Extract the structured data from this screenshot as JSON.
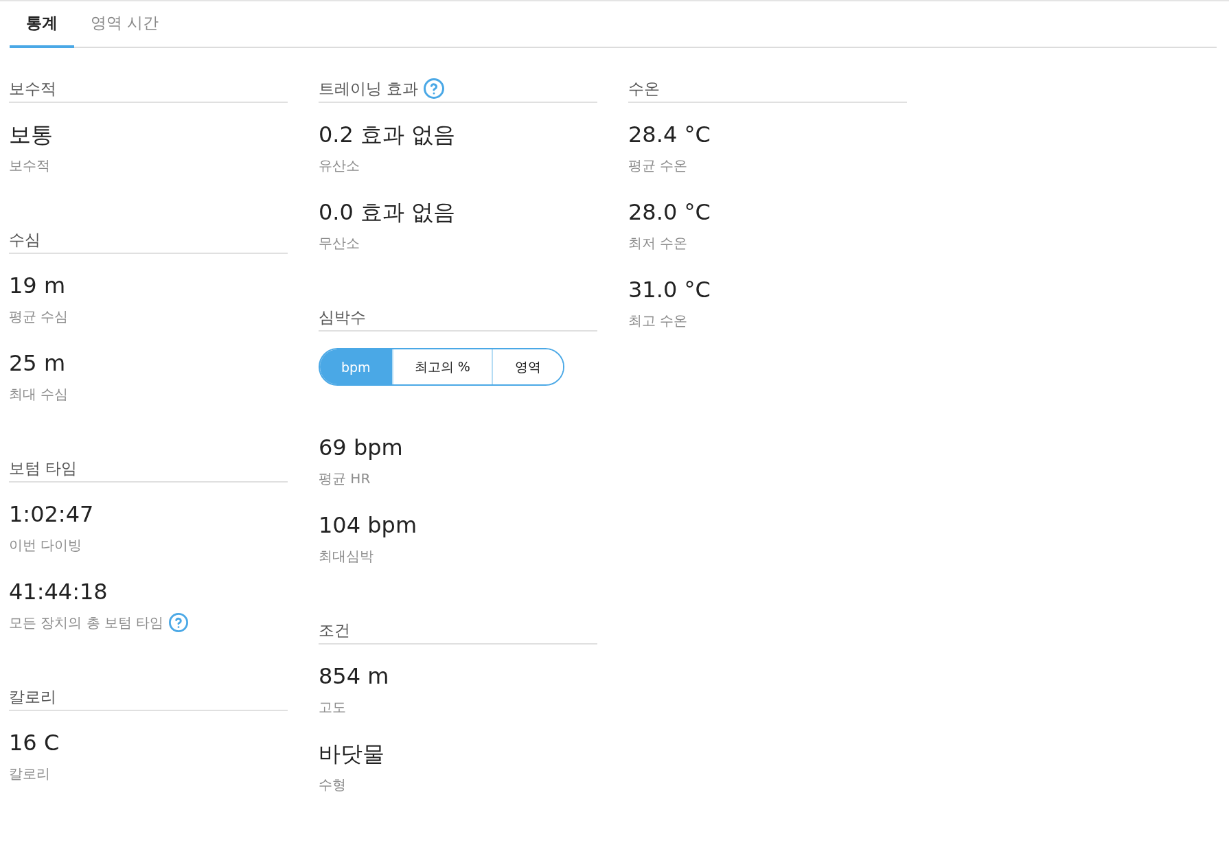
{
  "tabs": [
    {
      "label": "통계",
      "selected": true
    },
    {
      "label": "영역 시간",
      "selected": false
    }
  ],
  "columns": [
    {
      "sections": [
        {
          "title": "보수적",
          "help": false,
          "stats": [
            {
              "value": "보통",
              "label": "보수적",
              "help": false
            }
          ]
        },
        {
          "title": "수심",
          "help": false,
          "stats": [
            {
              "value": "19 m",
              "label": "평균 수심",
              "help": false
            },
            {
              "value": "25 m",
              "label": "최대 수심",
              "help": false
            }
          ]
        },
        {
          "title": "보텀 타임",
          "help": false,
          "stats": [
            {
              "value": "1:02:47",
              "label": "이번 다이빙",
              "help": false
            },
            {
              "value": "41:44:18",
              "label": "모든 장치의 총 보텀 타임",
              "help": true
            }
          ]
        },
        {
          "title": "칼로리",
          "help": false,
          "stats": [
            {
              "value": "16 C",
              "label": "칼로리",
              "help": false
            }
          ]
        }
      ]
    },
    {
      "sections": [
        {
          "title": "트레이닝 효과",
          "help": true,
          "stats": [
            {
              "value": "0.2 효과 없음",
              "label": "유산소",
              "help": false
            },
            {
              "value": "0.0 효과 없음",
              "label": "무산소",
              "help": false
            }
          ]
        },
        {
          "title": "심박수",
          "help": false,
          "segments": [
            {
              "label": "bpm",
              "selected": true
            },
            {
              "label": "최고의 %",
              "selected": false
            },
            {
              "label": "영역",
              "selected": false
            }
          ],
          "stats": [
            {
              "value": "69 bpm",
              "label": "평균 HR",
              "help": false
            },
            {
              "value": "104 bpm",
              "label": "최대심박",
              "help": false
            }
          ]
        },
        {
          "title": "조건",
          "help": false,
          "stats": [
            {
              "value": "854 m",
              "label": "고도",
              "help": false
            },
            {
              "value": "바닷물",
              "label": "수형",
              "help": false
            }
          ]
        }
      ]
    },
    {
      "sections": [
        {
          "title": "수온",
          "help": false,
          "stats": [
            {
              "value": "28.4 °C",
              "label": "평균 수온",
              "help": false
            },
            {
              "value": "28.0 °C",
              "label": "최저 수온",
              "help": false
            },
            {
              "value": "31.0 °C",
              "label": "최고 수온",
              "help": false
            }
          ]
        }
      ]
    }
  ]
}
